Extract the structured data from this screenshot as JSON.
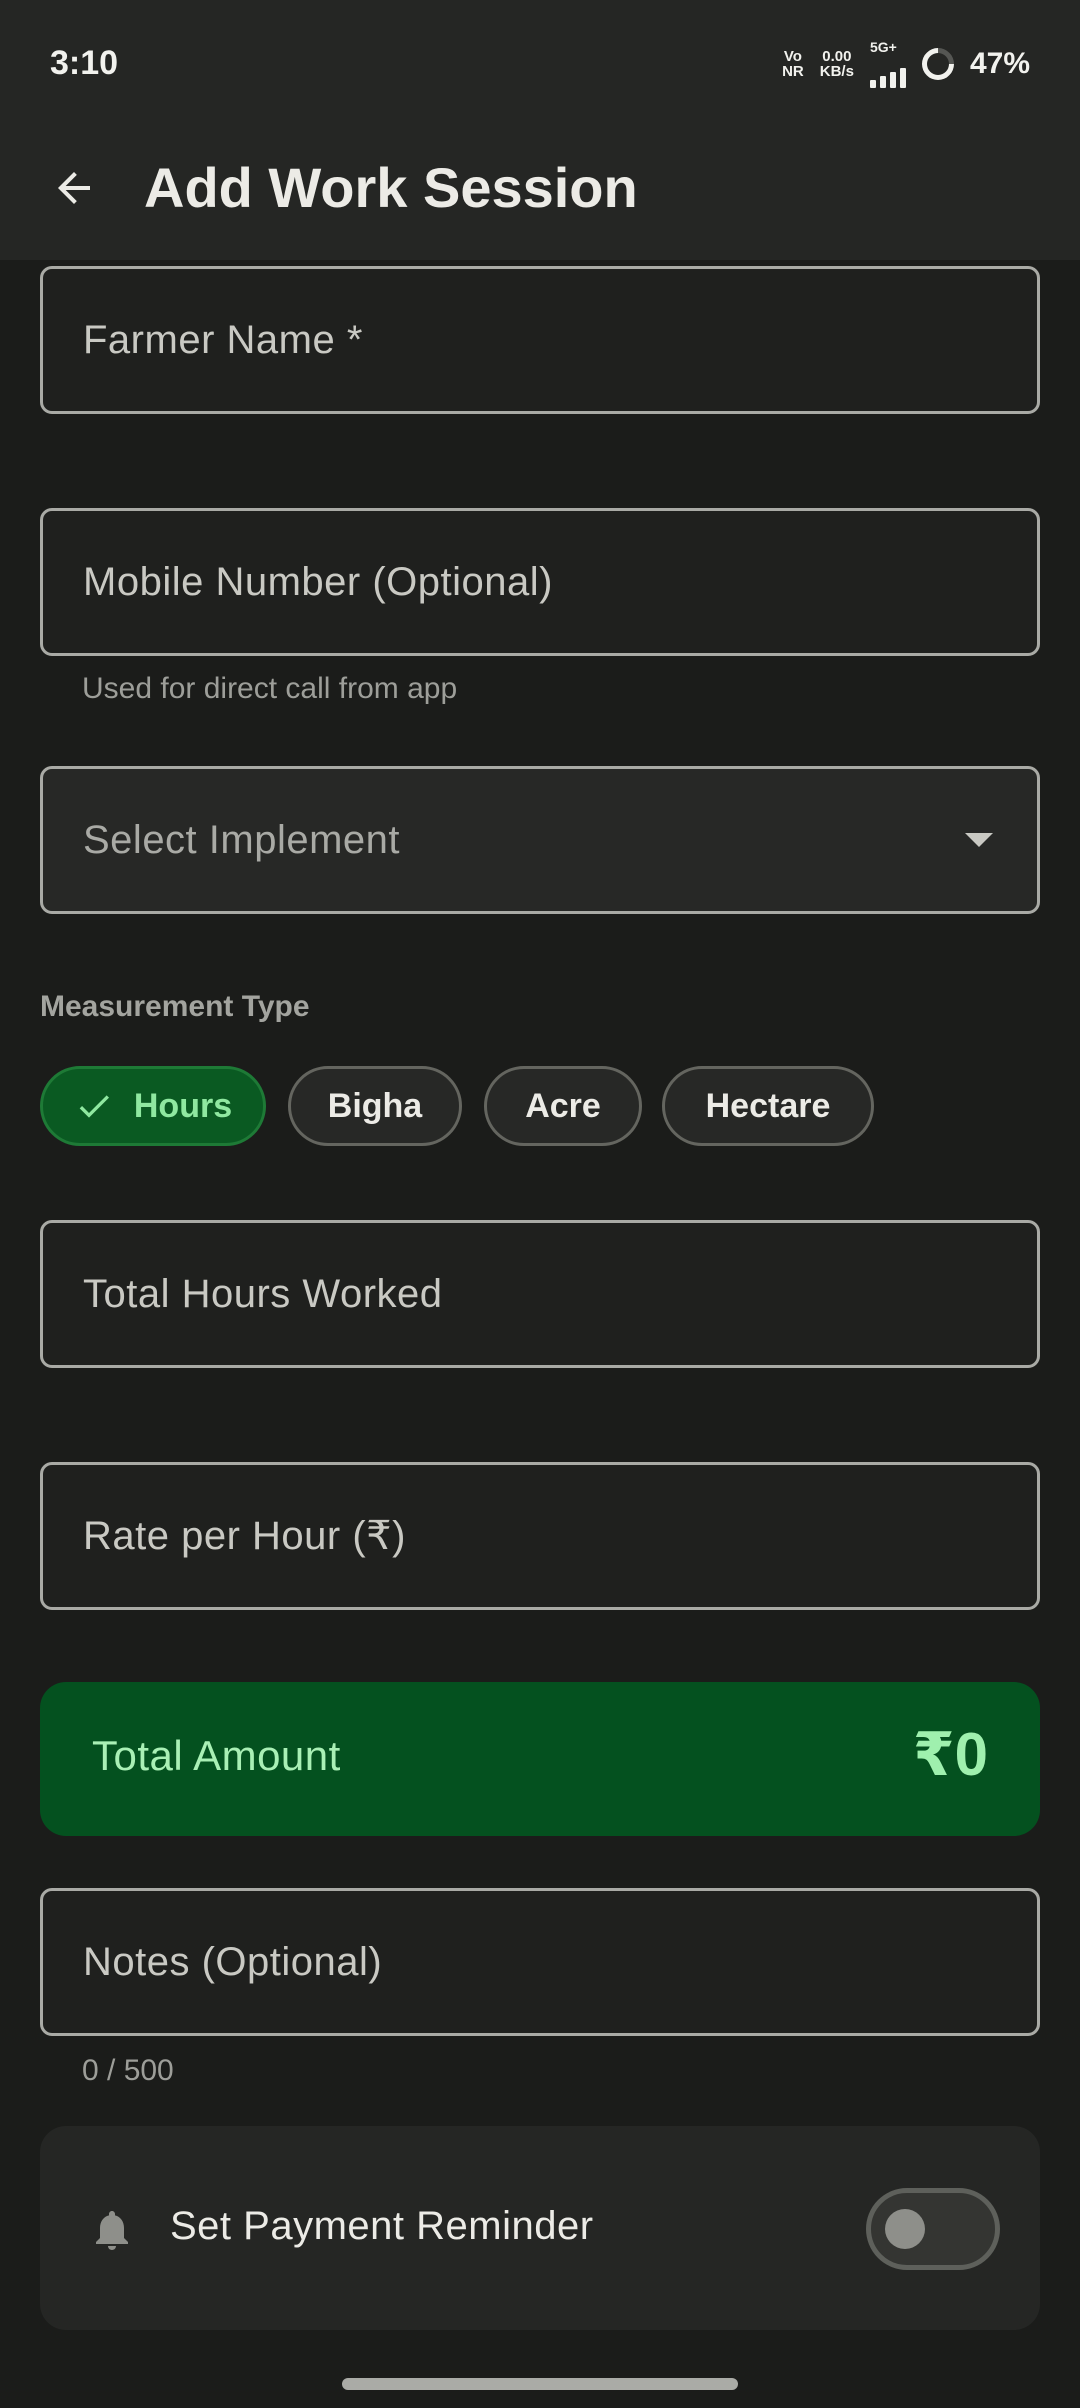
{
  "status_bar": {
    "time": "3:10",
    "volte_top": "Vo",
    "volte_bottom": "NR",
    "speed_value": "0.00",
    "speed_unit": "KB/s",
    "network": "5G+",
    "battery_percent": "47%"
  },
  "app_bar": {
    "title": "Add Work Session",
    "back_icon": "arrow-back-icon"
  },
  "form": {
    "farmer_name_label": "Farmer Name *",
    "mobile_label": "Mobile Number (Optional)",
    "mobile_helper": "Used for direct call from app",
    "implement_placeholder": "Select Implement",
    "measurement_type_label": "Measurement Type",
    "measurement_options": [
      {
        "label": "Hours",
        "selected": true
      },
      {
        "label": "Bigha",
        "selected": false
      },
      {
        "label": "Acre",
        "selected": false
      },
      {
        "label": "Hectare",
        "selected": false
      }
    ],
    "total_hours_label": "Total Hours Worked",
    "rate_label": "Rate per Hour (₹)",
    "total_amount_label": "Total Amount",
    "total_amount_value": "₹0",
    "notes_label": "Notes (Optional)",
    "notes_counter": "0 / 500",
    "reminder_label": "Set Payment Reminder",
    "reminder_enabled": false
  },
  "colors": {
    "background": "#1b1c1a",
    "accent_green": "#04511f",
    "accent_text": "#9ff0ae"
  }
}
